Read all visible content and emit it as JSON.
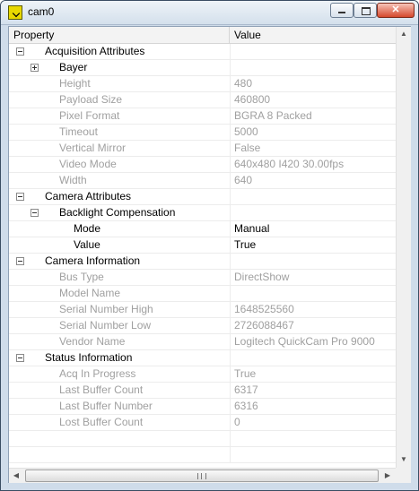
{
  "window": {
    "title": "cam0"
  },
  "grid": {
    "headers": {
      "property": "Property",
      "value": "Value"
    },
    "rows": [
      {
        "level": 0,
        "expander": "minus",
        "label": "Acquisition Attributes",
        "value": "",
        "enabled": true
      },
      {
        "level": 1,
        "expander": "plus",
        "label": "Bayer",
        "value": "",
        "enabled": true
      },
      {
        "level": 1,
        "expander": "",
        "label": "Height",
        "value": "480",
        "enabled": false
      },
      {
        "level": 1,
        "expander": "",
        "label": "Payload Size",
        "value": "460800",
        "enabled": false
      },
      {
        "level": 1,
        "expander": "",
        "label": "Pixel Format",
        "value": "BGRA 8 Packed",
        "enabled": false
      },
      {
        "level": 1,
        "expander": "",
        "label": "Timeout",
        "value": "5000",
        "enabled": false
      },
      {
        "level": 1,
        "expander": "",
        "label": "Vertical Mirror",
        "value": "False",
        "enabled": false
      },
      {
        "level": 1,
        "expander": "",
        "label": "Video Mode",
        "value": "640x480 I420 30.00fps",
        "enabled": false
      },
      {
        "level": 1,
        "expander": "",
        "label": "Width",
        "value": "640",
        "enabled": false
      },
      {
        "level": 0,
        "expander": "minus",
        "label": "Camera Attributes",
        "value": "",
        "enabled": true
      },
      {
        "level": 1,
        "expander": "minus",
        "label": "Backlight Compensation",
        "value": "",
        "enabled": true
      },
      {
        "level": 2,
        "expander": "",
        "label": "Mode",
        "value": "Manual",
        "enabled": true
      },
      {
        "level": 2,
        "expander": "",
        "label": "Value",
        "value": "True",
        "enabled": true
      },
      {
        "level": 0,
        "expander": "minus",
        "label": "Camera Information",
        "value": "",
        "enabled": true
      },
      {
        "level": 1,
        "expander": "",
        "label": "Bus Type",
        "value": "DirectShow",
        "enabled": false
      },
      {
        "level": 1,
        "expander": "",
        "label": "Model Name",
        "value": "",
        "enabled": false
      },
      {
        "level": 1,
        "expander": "",
        "label": "Serial Number High",
        "value": "1648525560",
        "enabled": false
      },
      {
        "level": 1,
        "expander": "",
        "label": "Serial Number Low",
        "value": "2726088467",
        "enabled": false
      },
      {
        "level": 1,
        "expander": "",
        "label": "Vendor Name",
        "value": "Logitech QuickCam Pro 9000",
        "enabled": false
      },
      {
        "level": 0,
        "expander": "minus",
        "label": "Status Information",
        "value": "",
        "enabled": true
      },
      {
        "level": 1,
        "expander": "",
        "label": "Acq In Progress",
        "value": "True",
        "enabled": false
      },
      {
        "level": 1,
        "expander": "",
        "label": "Last Buffer Count",
        "value": "6317",
        "enabled": false
      },
      {
        "level": 1,
        "expander": "",
        "label": "Last Buffer Number",
        "value": "6316",
        "enabled": false
      },
      {
        "level": 1,
        "expander": "",
        "label": "Lost Buffer Count",
        "value": "0",
        "enabled": false
      },
      {
        "level": -1,
        "expander": "",
        "label": "",
        "value": "",
        "enabled": true
      },
      {
        "level": -1,
        "expander": "",
        "label": "",
        "value": "",
        "enabled": true
      }
    ]
  },
  "colors": {
    "enabled_text": "#000000",
    "disabled_text": "#a0a0a0",
    "titlebar": "#d4e0ec",
    "close_button": "#d5482c"
  },
  "icons": {
    "app": "labview-vi-icon",
    "minimize": "minimize-icon",
    "maximize": "maximize-icon",
    "close": "close-icon",
    "expand": "plus-icon",
    "collapse": "minus-icon"
  }
}
